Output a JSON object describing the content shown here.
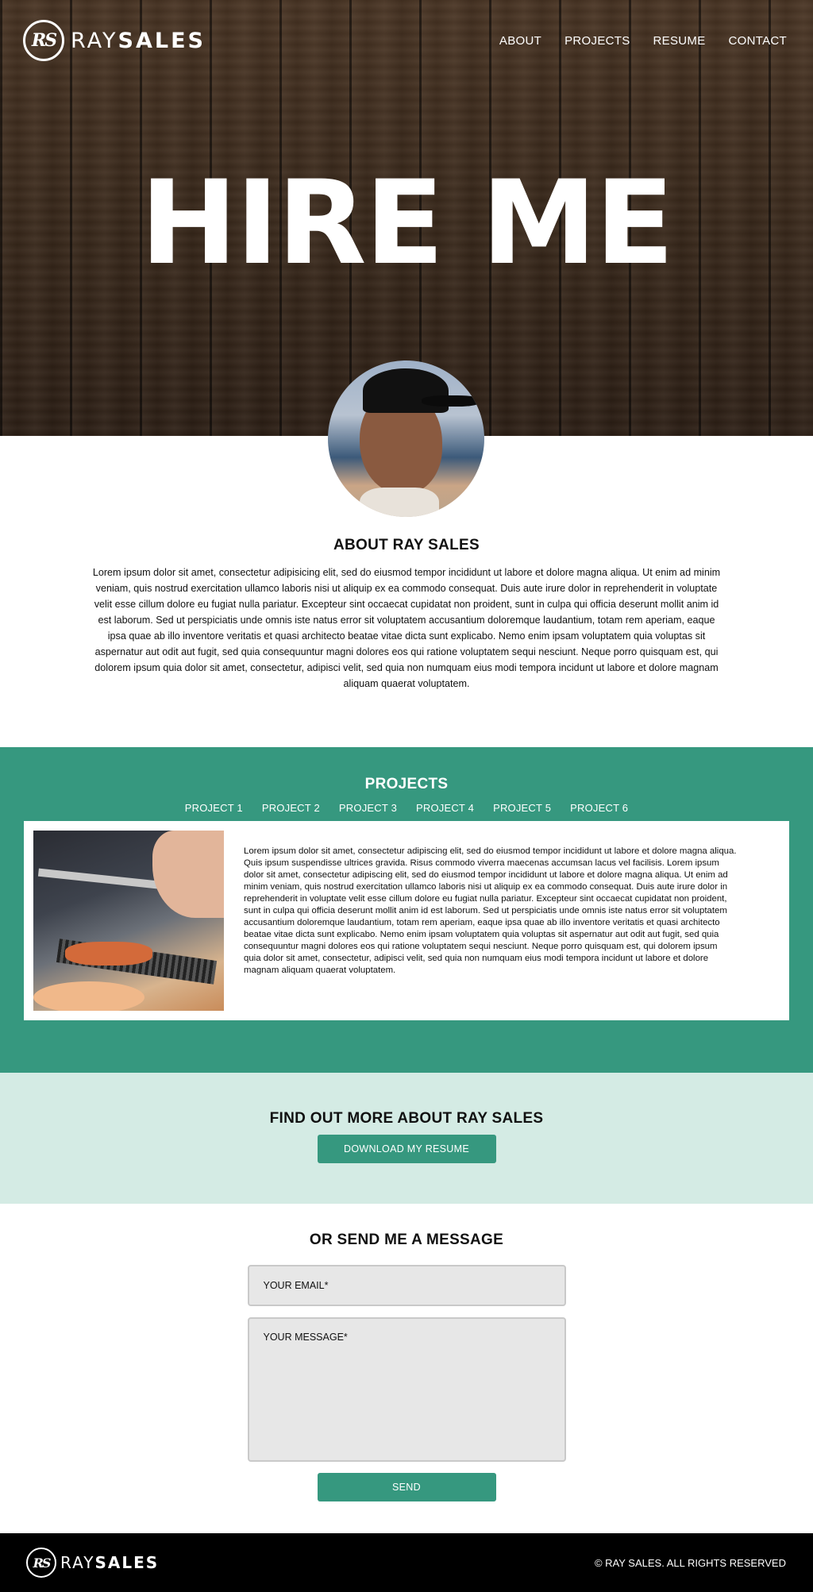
{
  "brand": {
    "initials": "RS",
    "name_light": "RAY",
    "name_bold": "SALES"
  },
  "nav": [
    {
      "label": "ABOUT"
    },
    {
      "label": "PROJECTS"
    },
    {
      "label": "RESUME"
    },
    {
      "label": "CONTACT"
    }
  ],
  "hero": {
    "title": "HIRE ME"
  },
  "about": {
    "title": "ABOUT RAY SALES",
    "text": "Lorem ipsum dolor sit amet, consectetur adipisicing elit, sed do eiusmod tempor incididunt ut labore et dolore magna aliqua. Ut enim ad minim veniam, quis nostrud exercitation ullamco laboris nisi ut aliquip ex ea commodo consequat. Duis aute irure dolor in reprehenderit in voluptate velit esse cillum dolore eu fugiat nulla pariatur. Excepteur sint occaecat cupidatat non proident, sunt in culpa qui officia deserunt mollit anim id est laborum. Sed ut perspiciatis unde omnis iste natus error sit voluptatem accusantium doloremque laudantium, totam rem aperiam, eaque ipsa quae ab illo inventore veritatis et quasi architecto beatae vitae dicta sunt explicabo. Nemo enim ipsam voluptatem quia voluptas sit aspernatur aut odit aut fugit, sed quia consequuntur magni dolores eos qui ratione voluptatem sequi nesciunt. Neque porro quisquam est, qui dolorem ipsum quia dolor sit amet, consectetur, adipisci velit, sed quia non numquam eius modi tempora incidunt ut labore et dolore magnam aliquam quaerat voluptatem."
  },
  "projects": {
    "title": "PROJECTS",
    "tabs": [
      {
        "label": "PROJECT 1"
      },
      {
        "label": "PROJECT 2"
      },
      {
        "label": "PROJECT 3"
      },
      {
        "label": "PROJECT 4"
      },
      {
        "label": "PROJECT 5"
      },
      {
        "label": "PROJECT 6"
      }
    ],
    "active": {
      "text": "Lorem ipsum dolor sit amet, consectetur adipiscing elit, sed do eiusmod tempor incididunt ut labore et dolore magna aliqua. Quis ipsum suspendisse ultrices gravida. Risus commodo viverra maecenas accumsan lacus vel facilisis. Lorem ipsum dolor sit amet, consectetur adipiscing elit, sed do eiusmod tempor incididunt ut labore et dolore magna aliqua. Ut enim ad minim veniam, quis nostrud exercitation ullamco laboris nisi ut aliquip ex ea commodo consequat. Duis aute irure dolor in reprehenderit in voluptate velit esse cillum dolore eu fugiat nulla pariatur. Excepteur sint occaecat cupidatat non proident, sunt in culpa qui officia deserunt mollit anim id est laborum. Sed ut perspiciatis unde omnis iste natus error sit voluptatem accusantium doloremque laudantium, totam rem aperiam, eaque ipsa quae ab illo inventore veritatis et quasi architecto beatae vitae dicta sunt explicabo. Nemo enim ipsam voluptatem quia voluptas sit aspernatur aut odit aut fugit, sed quia consequuntur magni dolores eos qui ratione voluptatem sequi nesciunt. Neque porro quisquam est, qui dolorem ipsum quia dolor sit amet, consectetur, adipisci velit, sed quia non numquam eius modi tempora incidunt ut labore et dolore magnam aliquam quaerat voluptatem."
    }
  },
  "resume": {
    "title": "FIND OUT MORE ABOUT RAY SALES",
    "button": "DOWNLOAD MY RESUME"
  },
  "contact": {
    "title": "OR SEND ME A MESSAGE",
    "email_placeholder": "YOUR EMAIL*",
    "message_placeholder": "YOUR MESSAGE*",
    "send": "SEND"
  },
  "footer": {
    "copyright": "© RAY SALES. ALL RIGHTS RESERVED"
  },
  "colors": {
    "accent": "#36987f",
    "accent_light": "#d4ebe4",
    "footer": "#000000"
  }
}
